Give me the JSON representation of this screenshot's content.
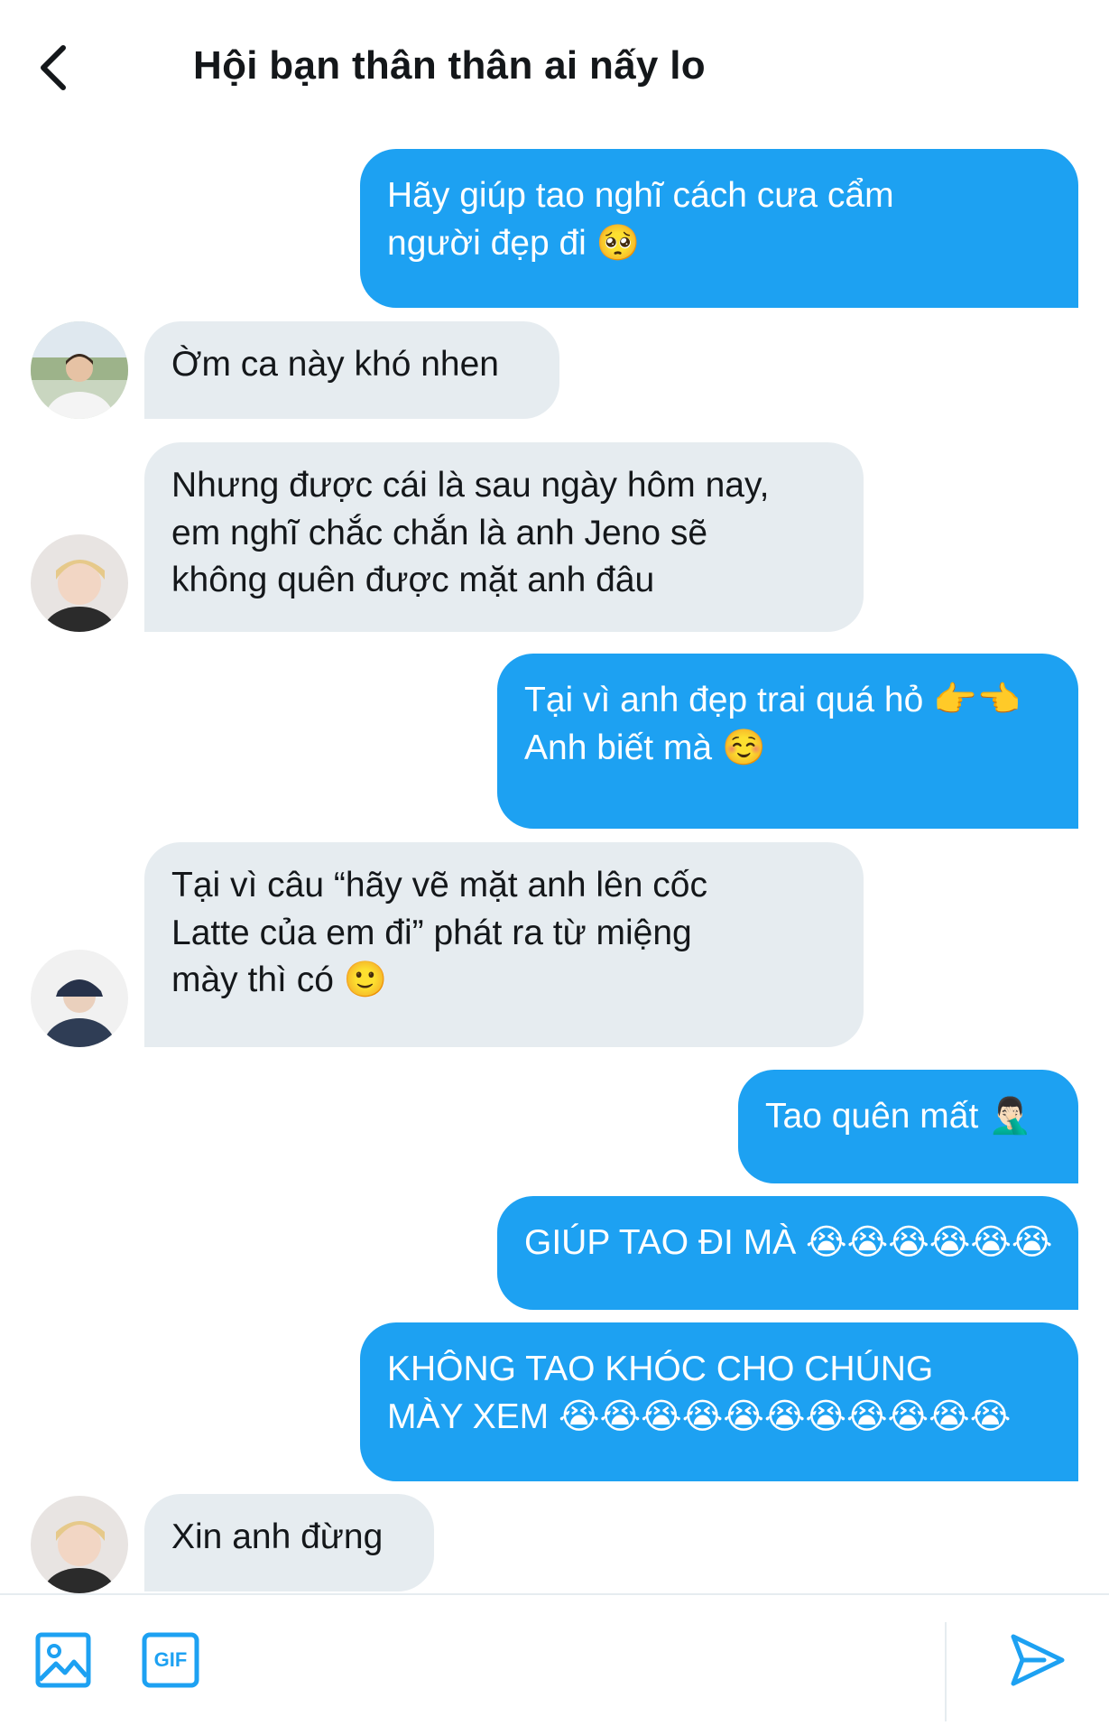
{
  "header": {
    "title": "Hội bạn thân thân ai nấy lo"
  },
  "messages": [
    {
      "dir": "out",
      "lines": [
        "Hãy giúp tao nghĩ cách cưa cẩm",
        "người đẹp đi 🥺"
      ]
    },
    {
      "dir": "in",
      "lines": [
        "Ờm ca này khó nhen"
      ]
    },
    {
      "dir": "in",
      "lines": [
        "Nhưng được cái là sau ngày hôm nay,",
        "em nghĩ chắc chắn là anh Jeno sẽ",
        "không quên được mặt anh đâu"
      ]
    },
    {
      "dir": "out",
      "lines": [
        "Tại vì anh đẹp trai quá hỏ 👉👈",
        "Anh biết mà ☺️"
      ]
    },
    {
      "dir": "in",
      "lines": [
        "Tại vì câu “hãy vẽ mặt anh lên cốc",
        "Latte của em đi” phát ra từ miệng",
        "mày thì có 🙂"
      ]
    },
    {
      "dir": "out",
      "lines": [
        "Tao quên mất 🤦🏻‍♂️"
      ]
    },
    {
      "dir": "out",
      "lines": [
        "GIÚP TAO ĐI MÀ 😭😭😭😭😭😭"
      ]
    },
    {
      "dir": "out",
      "lines": [
        "KHÔNG TAO KHÓC CHO CHÚNG",
        "MÀY XEM 😭😭😭😭😭😭😭😭😭😭😭"
      ]
    },
    {
      "dir": "in",
      "lines": [
        "Xin anh đừng"
      ]
    }
  ],
  "composer": {
    "gif_label": "GIF"
  },
  "colors": {
    "outgoing_bubble": "#1da1f2",
    "incoming_bubble": "#e6ecf0",
    "accent": "#1da1f2"
  },
  "icons": [
    "back-arrow-icon",
    "image-icon",
    "gif-icon",
    "send-icon"
  ]
}
